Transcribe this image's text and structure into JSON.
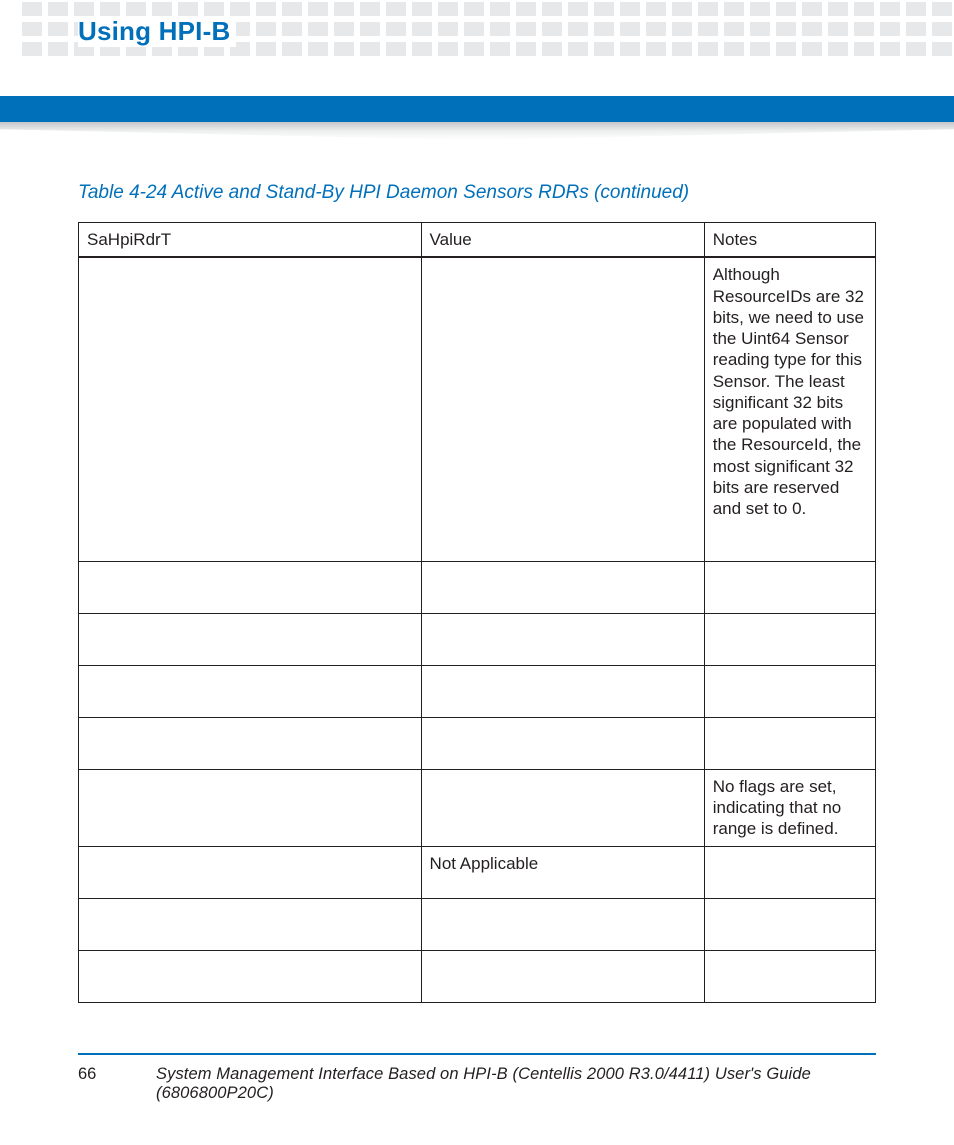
{
  "header": {
    "section_title": "Using HPI-B"
  },
  "table": {
    "caption": "Table 4-24 Active and Stand-By HPI Daemon Sensors RDRs (continued)",
    "columns": [
      "SaHpiRdrT",
      "Value",
      "Notes"
    ],
    "rows": [
      {
        "c1": "",
        "c2": "",
        "c3": "Although ResourceIDs are 32 bits, we need to use the Uint64 Sensor reading type for this Sensor. The least significant 32 bits are populated with the ResourceId, the most significant 32 bits are reserved and set to 0."
      },
      {
        "c1": "",
        "c2": "",
        "c3": ""
      },
      {
        "c1": "",
        "c2": "",
        "c3": ""
      },
      {
        "c1": "",
        "c2": "",
        "c3": ""
      },
      {
        "c1": "",
        "c2": "",
        "c3": ""
      },
      {
        "c1": "",
        "c2": "",
        "c3": "No flags are set, indicating that no range is defined."
      },
      {
        "c1": "",
        "c2": "Not Applicable",
        "c3": ""
      },
      {
        "c1": "",
        "c2": "",
        "c3": ""
      },
      {
        "c1": "",
        "c2": "",
        "c3": ""
      }
    ]
  },
  "footer": {
    "page_number": "66",
    "doc_title": "System Management Interface Based on HPI-B (Centellis 2000 R3.0/4411) User's Guide (6806800P20C)"
  }
}
